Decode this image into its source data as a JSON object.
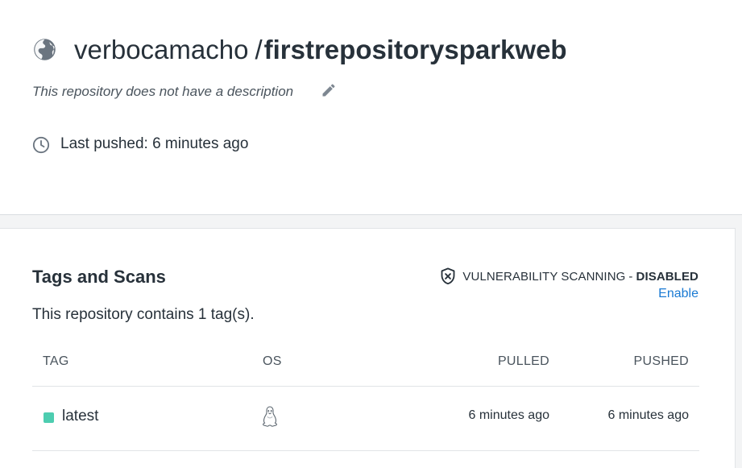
{
  "repo": {
    "owner": "verbocamacho",
    "separator": "/",
    "name": "firstrepositorysparkweb",
    "description": "This repository does not have a description",
    "last_pushed": "Last pushed: 6 minutes ago",
    "visibility_icon": "globe-icon"
  },
  "tags_card": {
    "title": "Tags and Scans",
    "summary": "This repository contains 1 tag(s).",
    "vulnerability": {
      "label": "VULNERABILITY SCANNING",
      "dash": "-",
      "status": "DISABLED",
      "enable_link": "Enable"
    },
    "columns": {
      "tag": "TAG",
      "os": "OS",
      "pulled": "PULLED",
      "pushed": "PUSHED"
    },
    "rows": [
      {
        "tag": "latest",
        "os_icon": "linux-icon",
        "pulled": "6 minutes ago",
        "pushed": "6 minutes ago",
        "status_color": "#4dcdb0"
      }
    ]
  },
  "colors": {
    "text": "#27313a",
    "link": "#1a7ad3",
    "tag_dot": "#4dcdb0",
    "band": "#f3f4f5"
  }
}
